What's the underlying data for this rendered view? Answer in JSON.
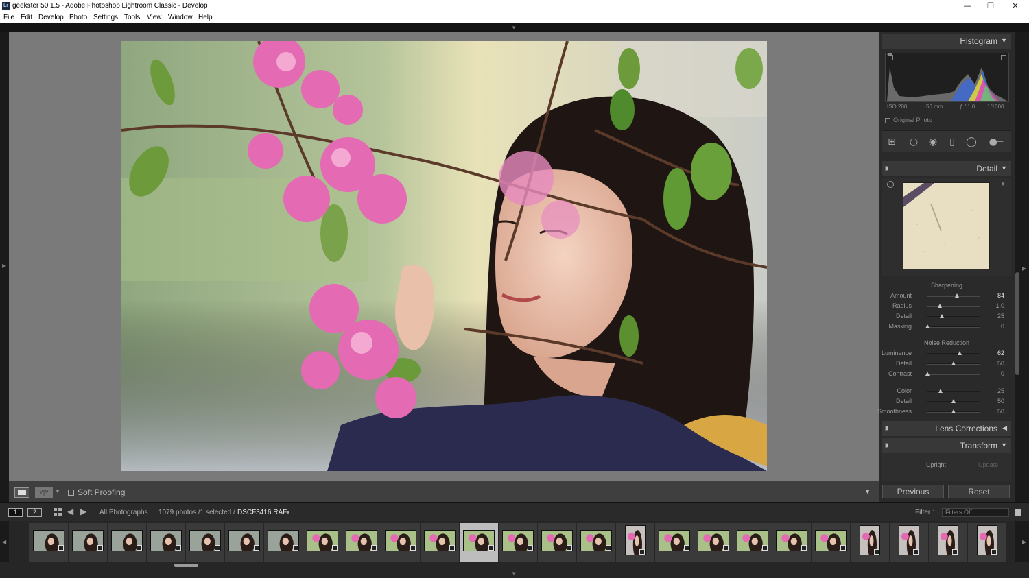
{
  "window": {
    "title": "geekster 50 1.5 - Adobe Photoshop Lightroom Classic - Develop",
    "app_icon_text": "Lr",
    "minimize_glyph": "—",
    "maximize_glyph": "❐",
    "close_glyph": "✕"
  },
  "menu": [
    "File",
    "Edit",
    "Develop",
    "Photo",
    "Settings",
    "Tools",
    "View",
    "Window",
    "Help"
  ],
  "toolbar": {
    "yy_label": "Y|Y",
    "soft_proofing": "Soft Proofing"
  },
  "histogram": {
    "title": "Histogram",
    "iso": "ISO 200",
    "focal": "50 mm",
    "aperture": "ƒ / 1.0",
    "shutter": "1/1000",
    "original_photo": "Original Photo"
  },
  "detail": {
    "title": "Detail",
    "sharpening_title": "Sharpening",
    "sharpening": [
      {
        "label": "Amount",
        "value": "84",
        "pos": 0.56,
        "hi": true
      },
      {
        "label": "Radius",
        "value": "1.0",
        "pos": 0.24,
        "hi": false
      },
      {
        "label": "Detail",
        "value": "25",
        "pos": 0.28,
        "hi": false
      },
      {
        "label": "Masking",
        "value": "0",
        "pos": 0.0,
        "hi": false
      }
    ],
    "noise_title": "Noise Reduction",
    "noise": [
      {
        "label": "Luminance",
        "value": "62",
        "pos": 0.62,
        "hi": true
      },
      {
        "label": "Detail",
        "value": "50",
        "pos": 0.5,
        "hi": false
      },
      {
        "label": "Contrast",
        "value": "0",
        "pos": 0.0,
        "hi": false
      }
    ],
    "color": [
      {
        "label": "Color",
        "value": "25",
        "pos": 0.25,
        "hi": false
      },
      {
        "label": "Detail",
        "value": "50",
        "pos": 0.5,
        "hi": false
      },
      {
        "label": "Smoothness",
        "value": "50",
        "pos": 0.5,
        "hi": false
      }
    ]
  },
  "panels": {
    "lens": "Lens Corrections",
    "transform": "Transform",
    "upright": "Upright",
    "update": "Update"
  },
  "buttons": {
    "previous": "Previous",
    "reset": "Reset"
  },
  "filmbar": {
    "mon1": "1",
    "mon2": "2",
    "source": "All Photographs",
    "count": "1079 photos /1 selected /",
    "filename": "DSCF3416.RAF",
    "filter_label": "Filter :",
    "filter_value": "Filters Off"
  },
  "filmstrip": {
    "thumbs": [
      "l",
      "l",
      "l",
      "l",
      "l",
      "l",
      "l",
      "f",
      "f",
      "f",
      "f",
      "s",
      "f",
      "f",
      "f",
      "p",
      "f",
      "f",
      "f",
      "f",
      "f",
      "p",
      "p",
      "p",
      "p"
    ],
    "selected_index": 11
  },
  "colors": {
    "accent": "#e6e6e6",
    "panel": "#2a2a2a",
    "viewer_bg": "#7a7a7a"
  }
}
